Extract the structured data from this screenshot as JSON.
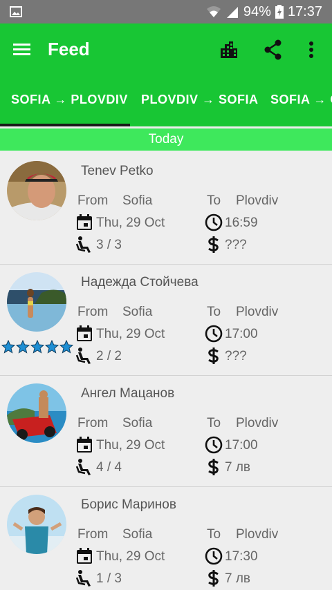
{
  "status_bar": {
    "battery": "94%",
    "time": "17:37"
  },
  "app_bar": {
    "title": "Feed"
  },
  "tabs": [
    "SOFIA → PLOVDIV",
    "PLOVDIV → SOFIA",
    "SOFIA → O"
  ],
  "section_header": "Today",
  "labels": {
    "from": "From",
    "to": "To"
  },
  "rides": [
    {
      "name": "Tenev Petko",
      "from": "Sofia",
      "to": "Plovdiv",
      "date": "Thu, 29 Oct",
      "time": "16:59",
      "seats": "3 / 3",
      "price": "???",
      "rating": 0
    },
    {
      "name": "Надежда Стойчева",
      "from": "Sofia",
      "to": "Plovdiv",
      "date": "Thu, 29 Oct",
      "time": "17:00",
      "seats": "2 / 2",
      "price": "???",
      "rating": 5
    },
    {
      "name": "Ангел Мацанов",
      "from": "Sofia",
      "to": "Plovdiv",
      "date": "Thu, 29 Oct",
      "time": "17:00",
      "seats": "4 / 4",
      "price": "7 лв",
      "rating": 0
    },
    {
      "name": "Борис Маринов",
      "from": "Sofia",
      "to": "Plovdiv",
      "date": "Thu, 29 Oct",
      "time": "17:30",
      "seats": "1 / 3",
      "price": "7 лв",
      "rating": 0
    }
  ],
  "colors": {
    "primary": "#18c634",
    "section": "#3ee85c",
    "status_bar": "#777777",
    "star": "#1e8fd4"
  }
}
